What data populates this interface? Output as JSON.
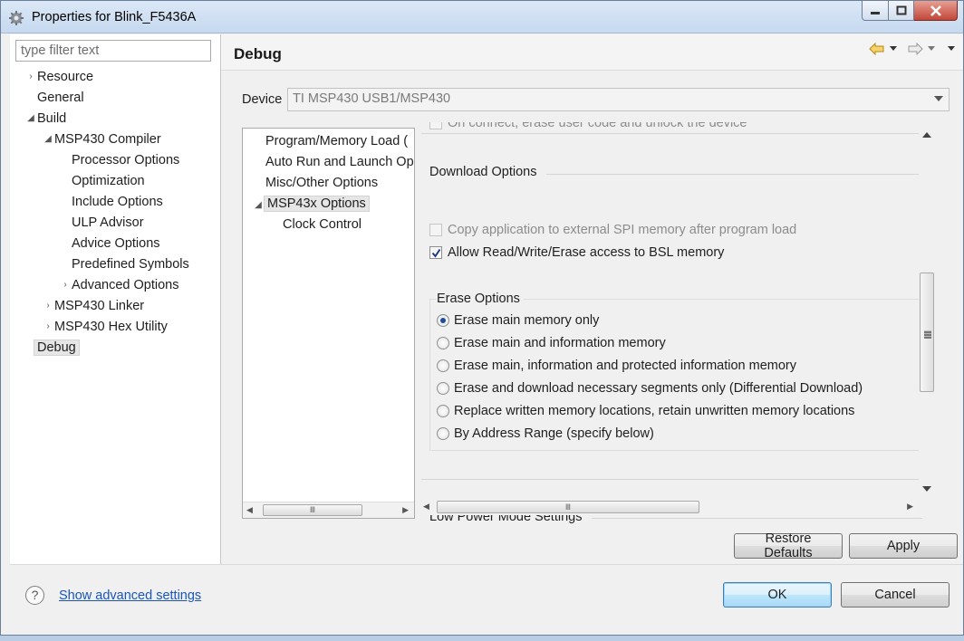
{
  "window": {
    "title": "Properties for Blink_F5436A"
  },
  "filter": {
    "placeholder": "type filter text"
  },
  "tree": {
    "items": [
      {
        "label": "Resource",
        "arrow": "›"
      },
      {
        "label": "General",
        "arrow": ""
      },
      {
        "label": "Build",
        "arrow": "◢"
      },
      {
        "label": "MSP430 Compiler",
        "arrow": "◢"
      },
      {
        "label": "Processor Options",
        "arrow": ""
      },
      {
        "label": "Optimization",
        "arrow": ""
      },
      {
        "label": "Include Options",
        "arrow": ""
      },
      {
        "label": "ULP Advisor",
        "arrow": ""
      },
      {
        "label": "Advice Options",
        "arrow": ""
      },
      {
        "label": "Predefined Symbols",
        "arrow": ""
      },
      {
        "label": "Advanced Options",
        "arrow": "›"
      },
      {
        "label": "MSP430 Linker",
        "arrow": "›"
      },
      {
        "label": "MSP430 Hex Utility",
        "arrow": "›"
      },
      {
        "label": "Debug",
        "arrow": ""
      }
    ]
  },
  "page": {
    "title": "Debug"
  },
  "device": {
    "label": "Device",
    "value": "TI MSP430 USB1/MSP430"
  },
  "categories": {
    "items": [
      {
        "label": "Program/Memory Load (",
        "arrow": ""
      },
      {
        "label": "Auto Run and Launch Op",
        "arrow": ""
      },
      {
        "label": "Misc/Other Options",
        "arrow": ""
      },
      {
        "label": "MSP43x Options",
        "arrow": "◢"
      },
      {
        "label": "Clock Control",
        "arrow": ""
      }
    ]
  },
  "options": {
    "cut_top_text": "On connect, erase user code and unlock the device",
    "download": {
      "title": "Download Options",
      "copy_spi_label": "Copy application to external SPI memory after program load",
      "bsl_label": "Allow Read/Write/Erase access to BSL memory",
      "bsl_checked": true
    },
    "erase": {
      "title": "Erase Options",
      "choices": [
        "Erase main memory only",
        "Erase main and information memory",
        "Erase main, information and protected information memory",
        "Erase and download necessary segments only (Differential Download)",
        "Replace written memory locations, retain unwritten memory locations",
        "By Address Range (specify below)"
      ],
      "selected_index": 0
    },
    "low_power": {
      "title": "Low Power Mode Settings"
    }
  },
  "buttons": {
    "restore_defaults": "Restore Defaults",
    "apply": "Apply",
    "ok": "OK",
    "cancel": "Cancel"
  },
  "footer": {
    "help_symbol": "?",
    "advanced_link": "Show advanced settings"
  },
  "colors": {
    "link": "#1a56b8",
    "accent_radio": "#1f4c9e"
  }
}
